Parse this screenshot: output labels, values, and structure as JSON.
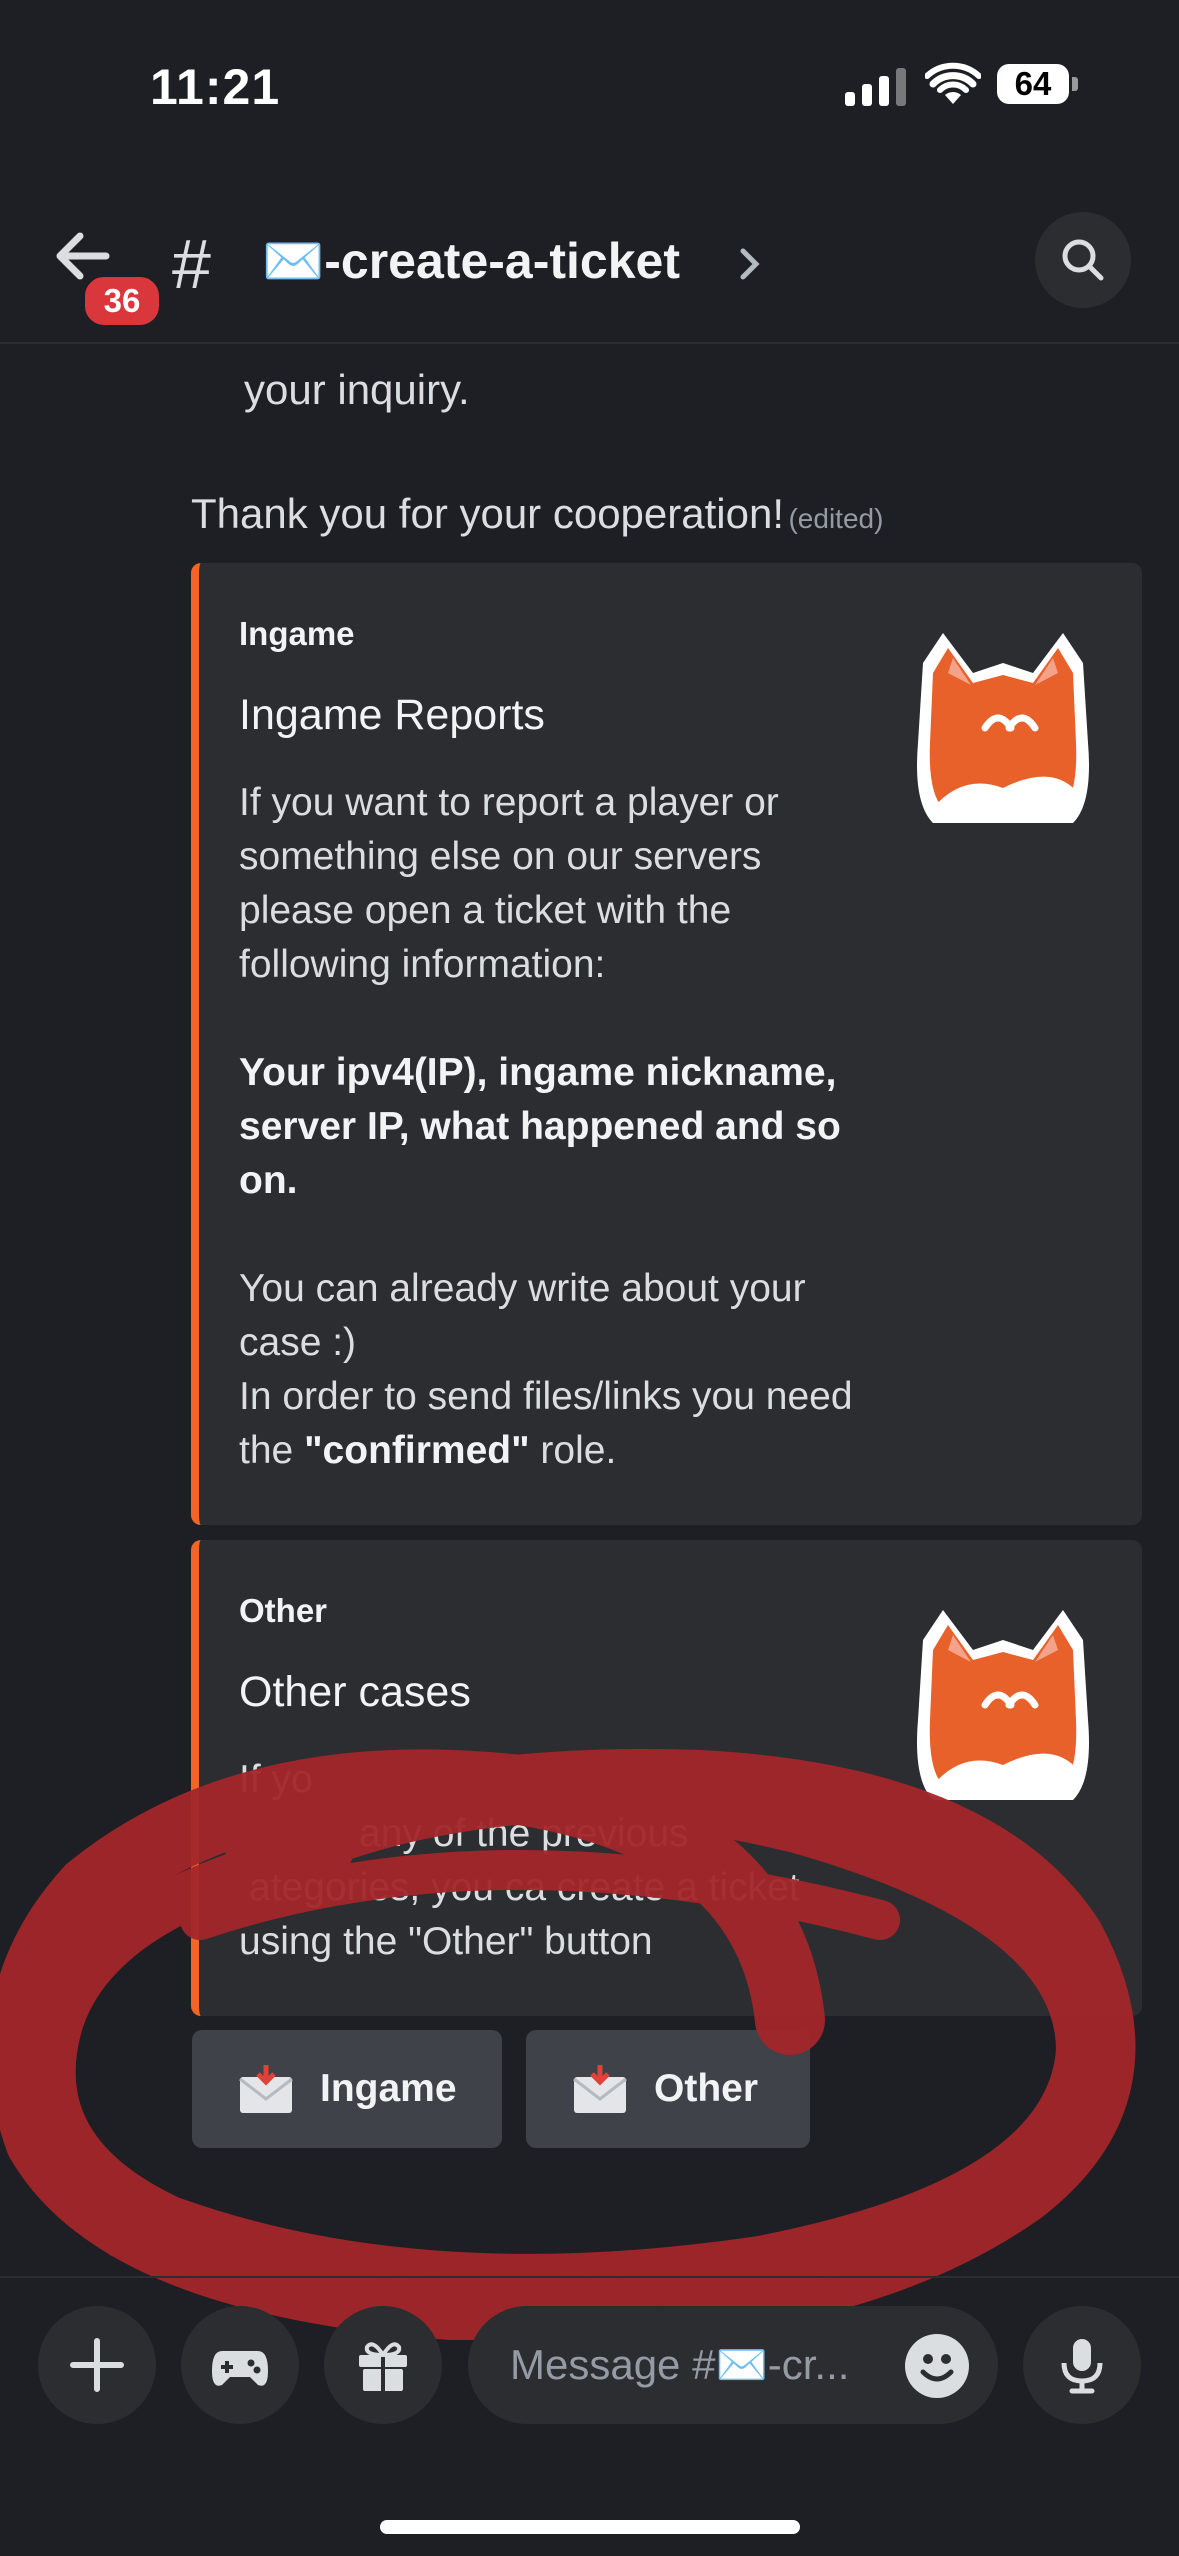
{
  "status_bar": {
    "time": "11:21",
    "battery": "64"
  },
  "header": {
    "unread_badge": "36",
    "hash": "#",
    "channel_name": "✉️-create-a-ticket"
  },
  "messages": {
    "inquiry_line": "your inquiry.",
    "thanks": "Thank you for your cooperation!",
    "edited": "(edited)"
  },
  "embeds": [
    {
      "author": "Ingame",
      "title": "Ingame Reports",
      "desc_1": "If you want to report a player or something else on our servers please open a ticket with the following information:",
      "desc_bold": "Your ipv4(IP), ingame nickname, server IP, what happened and so on.",
      "desc_3": "You can already write about your case :)",
      "desc_4_pre": "In order to send files/links you need the ",
      "desc_4_bold": "\"confirmed\"",
      "desc_4_post": " role."
    },
    {
      "author": "Other",
      "title": "Other cases",
      "desc_1": "If yo",
      "desc_2": "any of the previous",
      "desc_3": "ategories, you ca  create a ticket",
      "desc_4": "using the \"Other\" button"
    }
  ],
  "buttons": [
    {
      "label": "Ingame",
      "icon": "envelope-icon"
    },
    {
      "label": "Other",
      "icon": "envelope-icon"
    }
  ],
  "composer": {
    "placeholder": "Message #✉️-cr..."
  },
  "colors": {
    "accent": "#f26522",
    "annotation": "#a3262a",
    "background": "#1e1f24",
    "embed": "#2b2d31"
  }
}
